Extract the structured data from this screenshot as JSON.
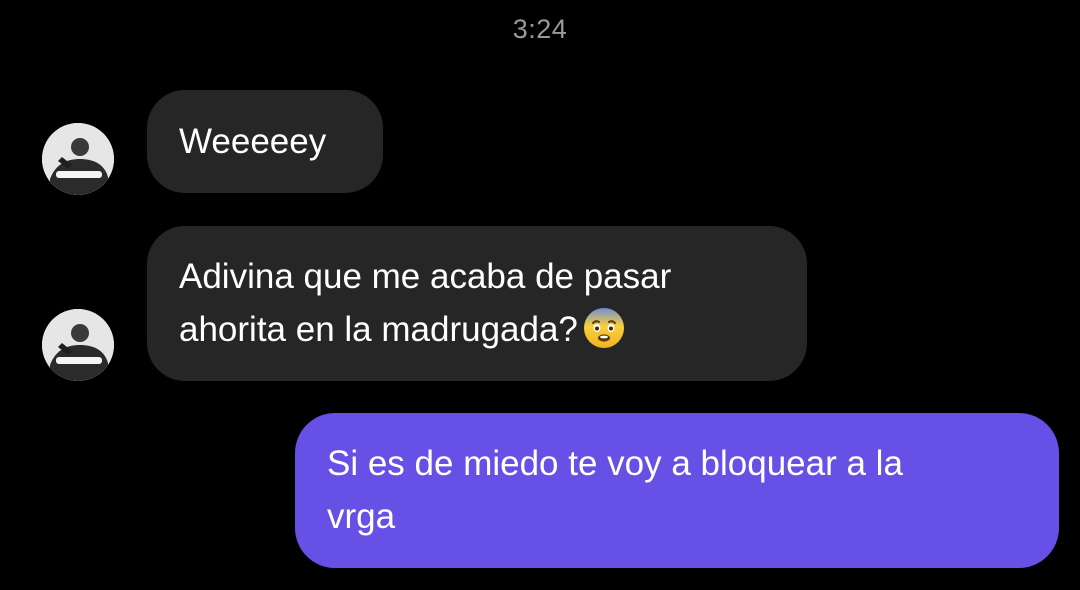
{
  "status": {
    "timestamp": "3:24"
  },
  "messages": [
    {
      "sender": "contact",
      "lines": [
        "Weeeeey"
      ]
    },
    {
      "sender": "contact",
      "lines": [
        "Adivina que me acaba de pasar",
        "ahorita en la madrugada?"
      ],
      "trailing_emoji": "fearful-face-emoji"
    },
    {
      "sender": "me",
      "lines": [
        "Si es de miedo te voy a bloquear a la",
        "vrga"
      ]
    }
  ],
  "colors": {
    "background": "#000000",
    "incoming_bubble": "#262626",
    "outgoing_bubble": "#6750e6",
    "timestamp_text": "#9a9a9a",
    "message_text": "#ffffff"
  }
}
